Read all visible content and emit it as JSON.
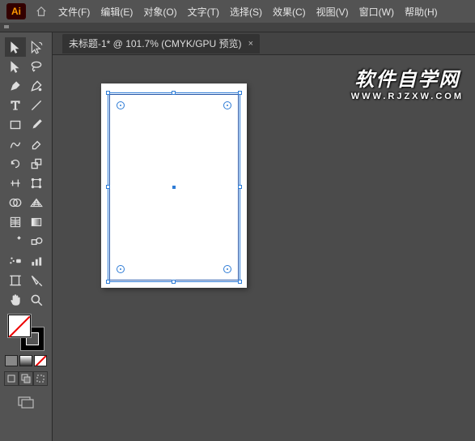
{
  "app": {
    "logo": "Ai"
  },
  "menu": [
    "文件(F)",
    "编辑(E)",
    "对象(O)",
    "文字(T)",
    "选择(S)",
    "效果(C)",
    "视图(V)",
    "窗口(W)",
    "帮助(H)"
  ],
  "tab": {
    "label": "未标题-1* @ 101.7%  (CMYK/GPU 预览)",
    "close": "×"
  },
  "watermark": {
    "main": "软件自学网",
    "sub": "WWW.RJZXW.COM"
  },
  "tools": [
    "selection",
    "direct-selection",
    "magic-wand",
    "lasso",
    "pen",
    "curvature",
    "type",
    "line-segment",
    "rectangle",
    "paintbrush",
    "shaper",
    "eraser",
    "rotate",
    "scale",
    "width",
    "free-transform",
    "shape-builder",
    "perspective",
    "mesh",
    "gradient",
    "eyedropper",
    "blend",
    "symbol-sprayer",
    "column-graph",
    "artboard",
    "slice",
    "hand",
    "zoom"
  ],
  "colors": {
    "fill": "none",
    "stroke": "#000000"
  }
}
